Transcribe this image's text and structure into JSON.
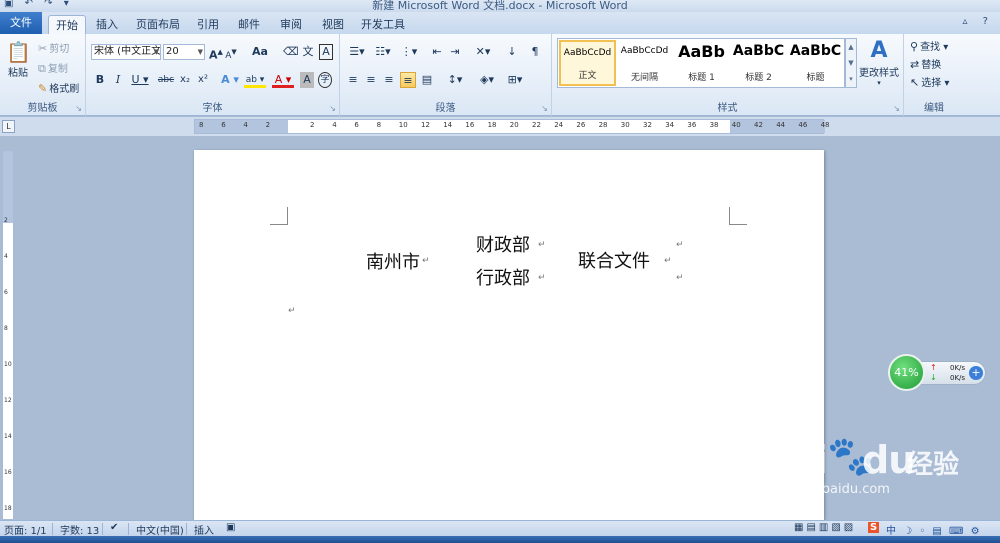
{
  "window": {
    "title": "新建 Microsoft Word 文档.docx - Microsoft Word"
  },
  "tabs": {
    "file": "文件",
    "items": [
      "开始",
      "插入",
      "页面布局",
      "引用",
      "邮件",
      "审阅",
      "视图",
      "开发工具"
    ],
    "active": "开始"
  },
  "ribbon": {
    "clipboard": {
      "label": "剪贴板",
      "paste": "粘贴",
      "cut": "剪切",
      "copy": "复制",
      "format_painter": "格式刷"
    },
    "font": {
      "label": "字体",
      "font_name": "宋体 (中文正文",
      "font_size": "20",
      "grow": "A",
      "shrink": "A",
      "change_case": "Aa",
      "bold": "B",
      "italic": "I",
      "underline": "U",
      "strike": "abc",
      "subscript": "x₂",
      "superscript": "x²",
      "text_effects": "A",
      "highlight": "ab",
      "font_color": "A",
      "char_shading": "A",
      "enclose": "字",
      "phonetic": "文",
      "border": "A"
    },
    "paragraph": {
      "label": "段落"
    },
    "styles": {
      "label": "样式",
      "items": [
        {
          "preview": "AaBbCcDd",
          "name": "正文"
        },
        {
          "preview": "AaBbCcDd",
          "name": "无间隔"
        },
        {
          "preview": "AaBb",
          "name": "标题 1"
        },
        {
          "preview": "AaBbC",
          "name": "标题 2"
        },
        {
          "preview": "AaBbC",
          "name": "标题"
        }
      ],
      "change_styles": "更改样式"
    },
    "editing": {
      "label": "编辑",
      "find": "查找",
      "replace": "替换",
      "select": "选择"
    }
  },
  "ruler": {
    "h_labels": [
      "8",
      "6",
      "4",
      "2",
      "",
      "2",
      "4",
      "6",
      "8",
      "10",
      "12",
      "14",
      "16",
      "18",
      "20",
      "22",
      "24",
      "26",
      "28",
      "30",
      "32",
      "34",
      "36",
      "38",
      "40",
      "42",
      "44",
      "46",
      "48"
    ],
    "v_labels": [
      "",
      "2",
      "4",
      "6",
      "8",
      "10",
      "12",
      "14",
      "16",
      "18"
    ]
  },
  "document": {
    "city": "南州市",
    "dept1": "财政部",
    "dept2": "行政部",
    "suffix": "联合文件",
    "para_mark": "↵"
  },
  "net_widget": {
    "percent": "41%",
    "up_speed": "0K/s",
    "down_speed": "0K/s"
  },
  "watermark": {
    "brand": "Bai",
    "brand_tail": "du",
    "cn": "经验",
    "url": "jingyan.baidu.com"
  },
  "statusbar": {
    "page": "页面: 1/1",
    "words": "字数: 13",
    "language": "中文(中国)",
    "mode": "插入"
  }
}
